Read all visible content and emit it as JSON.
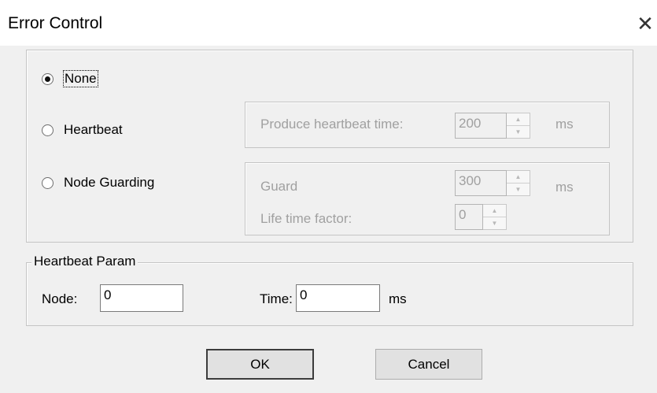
{
  "window": {
    "title": "Error Control",
    "close_glyph": "✕"
  },
  "mode": {
    "selected": "None",
    "options": [
      "None",
      "Heartbeat",
      "Node Guarding"
    ]
  },
  "heartbeat": {
    "produce_label": "Produce heartbeat time:",
    "produce_value": "200",
    "unit": "ms"
  },
  "guarding": {
    "guard_label": "Guard",
    "guard_value": "300",
    "guard_unit": "ms",
    "life_label": "Life time factor:",
    "life_value": "0"
  },
  "heartbeat_param": {
    "legend": "Heartbeat Param",
    "node_label": "Node:",
    "node_value": "0",
    "time_label": "Time:",
    "time_value": "0",
    "time_unit": "ms"
  },
  "buttons": {
    "ok": "OK",
    "cancel": "Cancel"
  },
  "icons": {
    "close": "close-icon",
    "spin_up": "spin-up-icon",
    "spin_down": "spin-down-icon"
  }
}
